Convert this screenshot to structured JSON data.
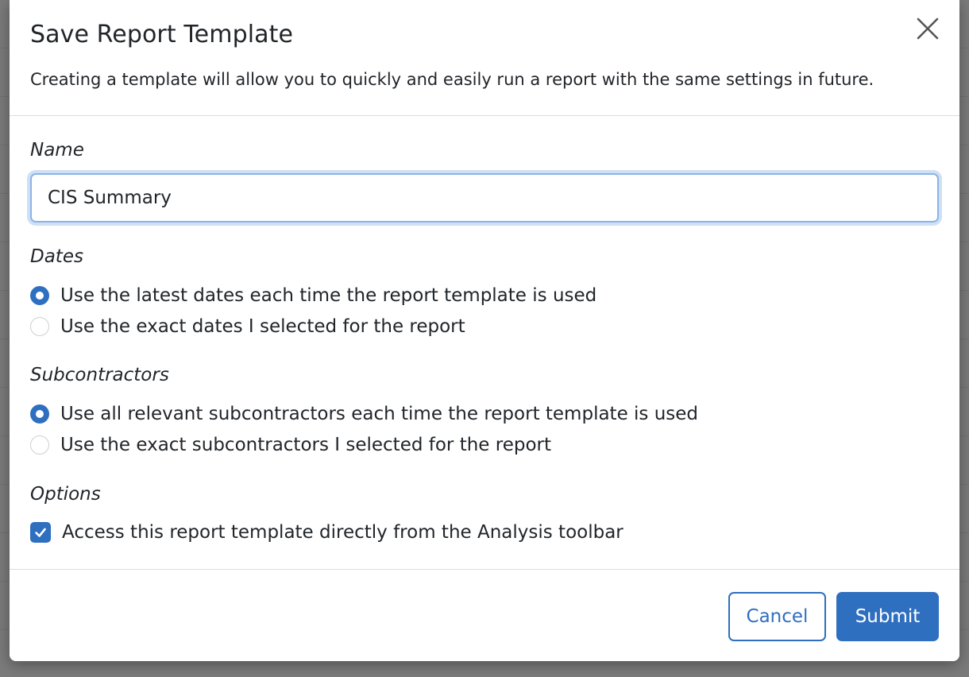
{
  "modal": {
    "title": "Save Report Template",
    "description": "Creating a template will allow you to quickly and easily run a report with the same settings in future."
  },
  "name_field": {
    "label": "Name",
    "value": "CIS Summary"
  },
  "dates": {
    "label": "Dates",
    "options": [
      {
        "label": "Use the latest dates each time the report template is used",
        "checked": true
      },
      {
        "label": "Use the exact dates I selected for the report",
        "checked": false
      }
    ]
  },
  "subcontractors": {
    "label": "Subcontractors",
    "options": [
      {
        "label": "Use all relevant subcontractors each time the report template is used",
        "checked": true
      },
      {
        "label": "Use the exact subcontractors I selected for the report",
        "checked": false
      }
    ]
  },
  "options": {
    "label": "Options",
    "items": [
      {
        "label": "Access this report template directly from the Analysis toolbar",
        "checked": true
      }
    ]
  },
  "footer": {
    "cancel_label": "Cancel",
    "submit_label": "Submit"
  },
  "colors": {
    "accent": "#2f6fc0",
    "focus_ring": "#cfe0f5",
    "backdrop": "#7b7b7b"
  },
  "icons": {
    "close": "close-icon",
    "check": "check-icon"
  }
}
